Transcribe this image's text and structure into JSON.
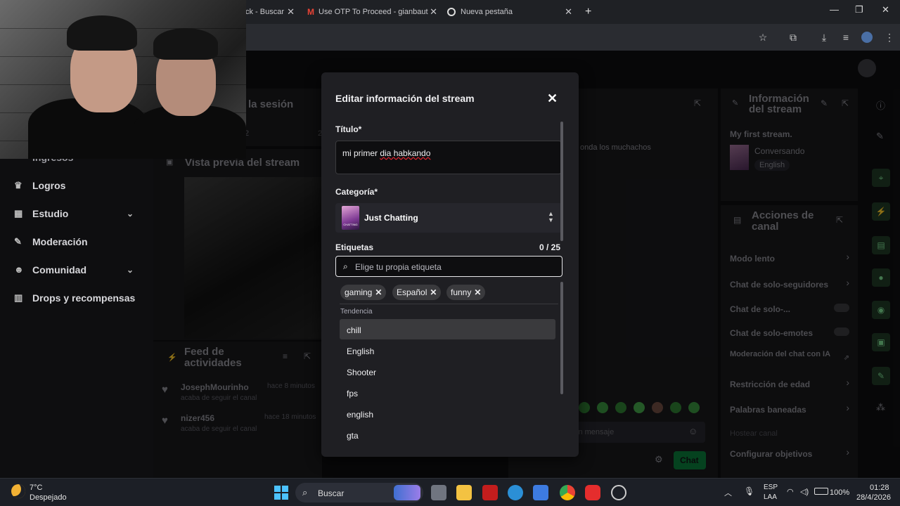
{
  "browser": {
    "tabs": [
      {
        "title": "ck - Buscar"
      },
      {
        "title": "Use OTP To Proceed - gianbaut"
      },
      {
        "title": "Nueva pestaña"
      }
    ],
    "new_tab": "+",
    "window_controls": {
      "minimize": "—",
      "maximize": "❐",
      "close": "✕"
    }
  },
  "dashboard": {
    "session_header": "o de la sesión",
    "session_subs": [
      "2",
      "2"
    ],
    "preview_title": "Vista previa del stream",
    "sidebar": {
      "partial_item": "Ingresos",
      "items": [
        {
          "label": "Logros",
          "icon": "trophy-icon",
          "expandable": false
        },
        {
          "label": "Estudio",
          "icon": "studio-icon",
          "expandable": true
        },
        {
          "label": "Moderación",
          "icon": "wrench-icon",
          "expandable": false
        },
        {
          "label": "Comunidad",
          "icon": "community-icon",
          "expandable": true
        },
        {
          "label": "Drops y recompensas",
          "icon": "drops-icon",
          "expandable": false
        }
      ]
    },
    "activity_feed": {
      "title_line1": "Feed de",
      "title_line2": "actividades",
      "items": [
        {
          "user": "JosephMourinho",
          "time": "hace 8 minutos",
          "action": "acaba de seguir el canal"
        },
        {
          "user": "nizer456",
          "time": "hace 18 minutos",
          "action": "acaba de seguir el canal"
        }
      ]
    },
    "chat": {
      "message_fragment": "onda los muchachos",
      "input_placeholder": "in mensaje",
      "send_label": "Chat"
    },
    "stream_info": {
      "title_line1": "Información",
      "title_line2": "del stream",
      "stream_title": "My first stream.",
      "category": "Conversando",
      "tag": "English"
    },
    "channel_actions": {
      "title_line1": "Acciones de",
      "title_line2": "canal",
      "items": [
        {
          "label": "Modo lento",
          "control": "chevron"
        },
        {
          "label": "Chat de solo-seguidores",
          "control": "chevron"
        },
        {
          "label": "Chat de solo-...",
          "control": "toggle"
        },
        {
          "label": "Chat de solo-emotes",
          "control": "toggle"
        },
        {
          "label": "Moderación del chat con IA",
          "control": "external"
        },
        {
          "label": "Restricción de edad",
          "control": "chevron"
        },
        {
          "label": "Palabras baneadas",
          "control": "chevron"
        },
        {
          "label": "Hostear canal",
          "control": "none"
        },
        {
          "label": "Configurar objetivos",
          "control": "chevron"
        }
      ]
    }
  },
  "modal": {
    "title": "Editar información del stream",
    "close_icon": "✕",
    "title_label": "Título*",
    "title_value_prefix": "mi primer ",
    "title_value_error": "dia habkando",
    "category_label": "Categoría*",
    "category_value": "Just Chatting",
    "category_thumb_text": "CHATTING",
    "tags_label": "Etiquetas",
    "tags_count": "0 / 25",
    "tag_search_placeholder": "Elige tu propia etiqueta",
    "selected_tags": [
      "gaming",
      "Español",
      "funny"
    ],
    "trending_label": "Tendencia",
    "suggestions": [
      "chill",
      "English",
      "Shooter",
      "fps",
      "english",
      "gta"
    ],
    "active_suggestion": 0
  },
  "taskbar": {
    "weather_temp": "7°C",
    "weather_desc": "Despejado",
    "search_label": "Buscar",
    "lang_line1": "ESP",
    "lang_line2": "LAA",
    "battery": "100%",
    "time": "01:28",
    "date": "28/4/2026"
  },
  "colors": {
    "background": "#0e0e10",
    "panel": "#18181b",
    "modal": "#1f1f23",
    "chat_button": "#00c853",
    "error_underline": "#e0242f",
    "taskbar": "#1c1f26"
  }
}
